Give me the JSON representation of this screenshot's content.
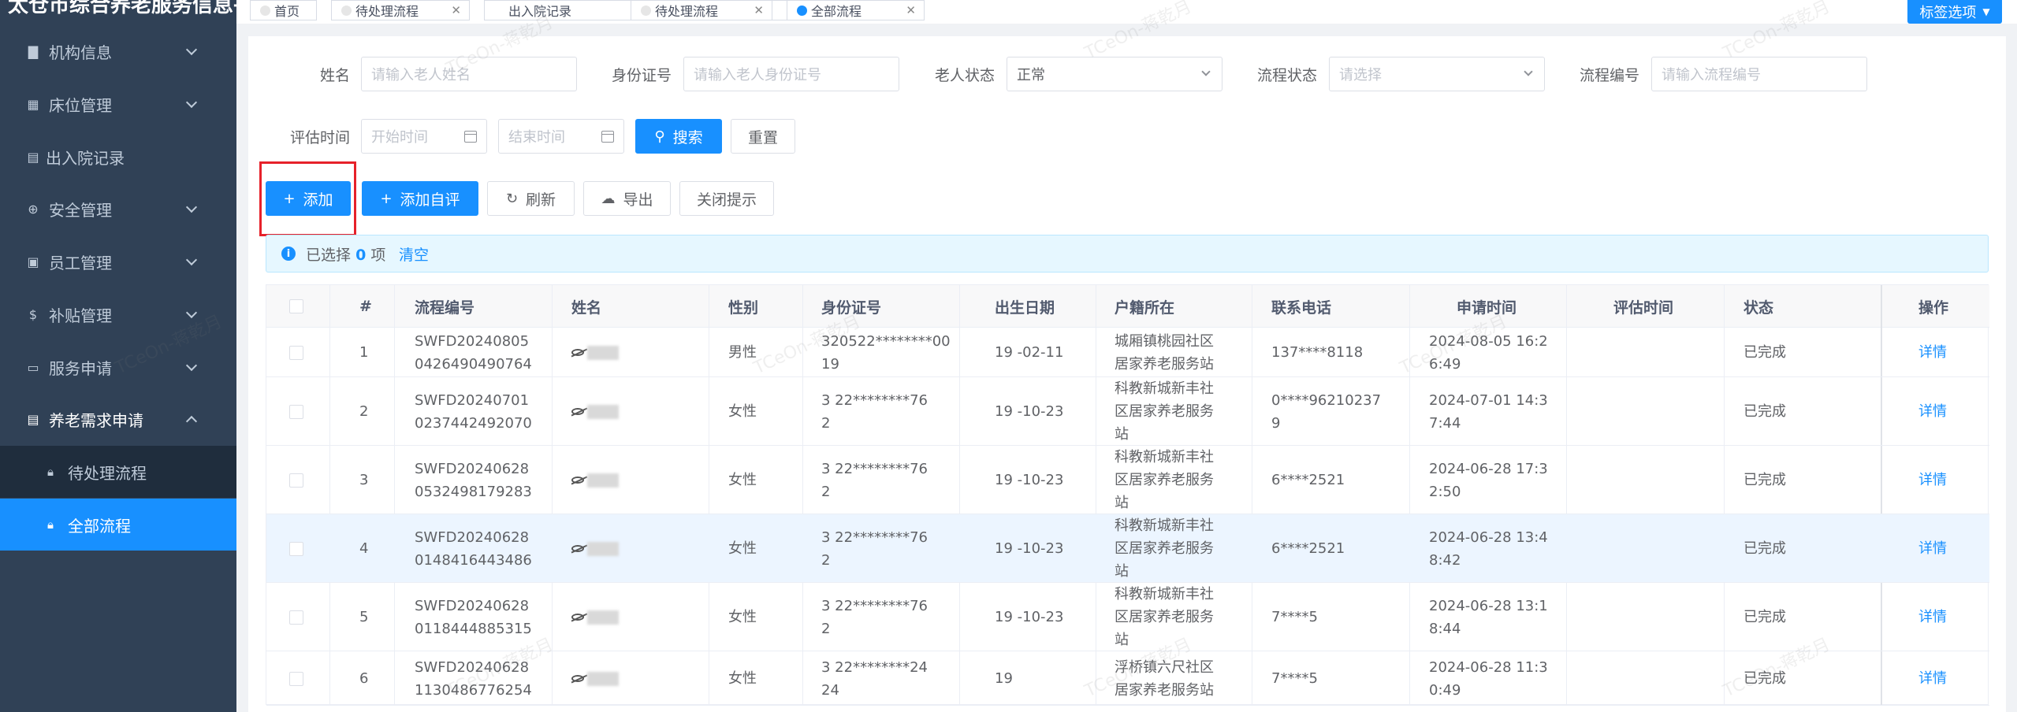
{
  "sidebar": {
    "title": "太仓市综合养老服务信息平台",
    "items": [
      {
        "label": "机构信息",
        "icon": "building-icon"
      },
      {
        "label": "床位管理",
        "icon": "grid-icon"
      },
      {
        "label": "出入院记录",
        "icon": "record-icon"
      },
      {
        "label": "安全管理",
        "icon": "shield-icon"
      },
      {
        "label": "员工管理",
        "icon": "user-icon"
      },
      {
        "label": "补贴管理",
        "icon": "dollar-icon"
      },
      {
        "label": "服务申请",
        "icon": "calendar-icon"
      },
      {
        "label": "养老需求申请",
        "icon": "document-icon"
      }
    ],
    "subitems": [
      {
        "label": "待处理流程",
        "icon": "lock-icon"
      },
      {
        "label": "全部流程",
        "icon": "lock-icon"
      }
    ]
  },
  "tabs": [
    {
      "label": "首页"
    },
    {
      "label": "待处理流程"
    },
    {
      "label": "出入院记录"
    },
    {
      "label": "待处理流程"
    },
    {
      "label": "全部流程"
    }
  ],
  "tag_options": "标签选项",
  "filters": {
    "name_label": "姓名",
    "name_placeholder": "请输入老人姓名",
    "id_label": "身份证号",
    "id_placeholder": "请输入老人身份证号",
    "elder_status_label": "老人状态",
    "elder_status_value": "正常",
    "flow_status_label": "流程状态",
    "flow_status_placeholder": "请选择",
    "flow_no_label": "流程编号",
    "flow_no_placeholder": "请输入流程编号",
    "eval_time_label": "评估时间",
    "start_placeholder": "开始时间",
    "end_placeholder": "结束时间",
    "search_btn": "搜索",
    "reset_btn": "重置"
  },
  "toolbar": {
    "add": "添加",
    "add_self": "添加自评",
    "refresh": "刷新",
    "export": "导出",
    "close_tip": "关闭提示"
  },
  "selection": {
    "prefix": "已选择",
    "count": "0",
    "suffix": "项",
    "clear": "清空"
  },
  "table": {
    "headers": [
      "#",
      "流程编号",
      "姓名",
      "性别",
      "身份证号",
      "出生日期",
      "户籍所在",
      "联系电话",
      "申请时间",
      "评估时间",
      "状态",
      "操作"
    ],
    "rows": [
      {
        "idx": "1",
        "flow_no": "SWFD20240805\n0426490490764",
        "name": "",
        "gender": "男性",
        "id_no": "320522********00\n19",
        "birth": "19  -02-11",
        "address": "城厢镇桃园社区\n居家养老服务站",
        "phone": "137****8118",
        "apply_time": "2024-08-05 16:2\n6:49",
        "eval_time": "",
        "status": "已完成",
        "action": "详情"
      },
      {
        "idx": "2",
        "flow_no": "SWFD20240701\n0237442492070",
        "name": "",
        "gender": "女性",
        "id_no": "3    22********76\n2",
        "birth": "19  -10-23",
        "address": "科教新城新丰社\n区居家养老服务\n站",
        "phone": "  0****96210237\n  9",
        "apply_time": "2024-07-01 14:3\n7:44",
        "eval_time": "",
        "status": "已完成",
        "action": "详情"
      },
      {
        "idx": "3",
        "flow_no": "SWFD20240628\n0532498179283",
        "name": "",
        "gender": "女性",
        "id_no": "3    22********76\n2",
        "birth": "19  -10-23",
        "address": "科教新城新丰社\n区居家养老服务\n站",
        "phone": "  6****2521",
        "apply_time": "2024-06-28 17:3\n2:50",
        "eval_time": "",
        "status": "已完成",
        "action": "详情"
      },
      {
        "idx": "4",
        "flow_no": "SWFD20240628\n0148416443486",
        "name": "",
        "gender": "女性",
        "id_no": "3    22********76\n2",
        "birth": "19  -10-23",
        "address": "科教新城新丰社\n区居家养老服务\n站",
        "phone": "  6****2521",
        "apply_time": "2024-06-28 13:4\n8:42",
        "eval_time": "",
        "status": "已完成",
        "action": "详情"
      },
      {
        "idx": "5",
        "flow_no": "SWFD20240628\n0118444885315",
        "name": "",
        "gender": "女性",
        "id_no": "3   22********76\n2",
        "birth": "19  -10-23",
        "address": "科教新城新丰社\n区居家养老服务\n站",
        "phone": "  7****5",
        "apply_time": "2024-06-28 13:1\n8:44",
        "eval_time": "",
        "status": "已完成",
        "action": "详情"
      },
      {
        "idx": "6",
        "flow_no": "SWFD20240628\n1130486776254",
        "name": "",
        "gender": "女性",
        "id_no": "3    22********24\n24",
        "birth": "19",
        "address": "浮桥镇六尺社区\n居家养老服务站",
        "phone": "  7****5",
        "apply_time": "2024-06-28 11:3\n0:49",
        "eval_time": "",
        "status": "已完成",
        "action": "详情"
      }
    ]
  }
}
